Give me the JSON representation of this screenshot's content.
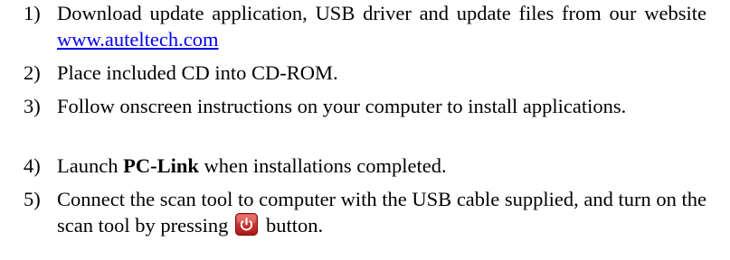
{
  "steps": [
    {
      "num": "1)",
      "text_before": "Download update application, USB driver and update files from our website ",
      "link": "www.auteltech.com"
    },
    {
      "num": "2)",
      "text": "Place included CD into CD-ROM."
    },
    {
      "num": "3)",
      "text": "Follow onscreen instructions on your computer to install applications."
    },
    {
      "num": "4)",
      "text_before": "Launch ",
      "bold": "PC-Link",
      "text_after": " when installations completed."
    },
    {
      "num": "5)",
      "text_before": "Connect the scan tool to computer with the USB cable supplied, and turn on the scan tool by pressing ",
      "icon": "power-icon",
      "text_after": "button."
    }
  ],
  "colors": {
    "text": "#000000",
    "link": "#0000ee",
    "icon_bg": "#c81e1e"
  }
}
